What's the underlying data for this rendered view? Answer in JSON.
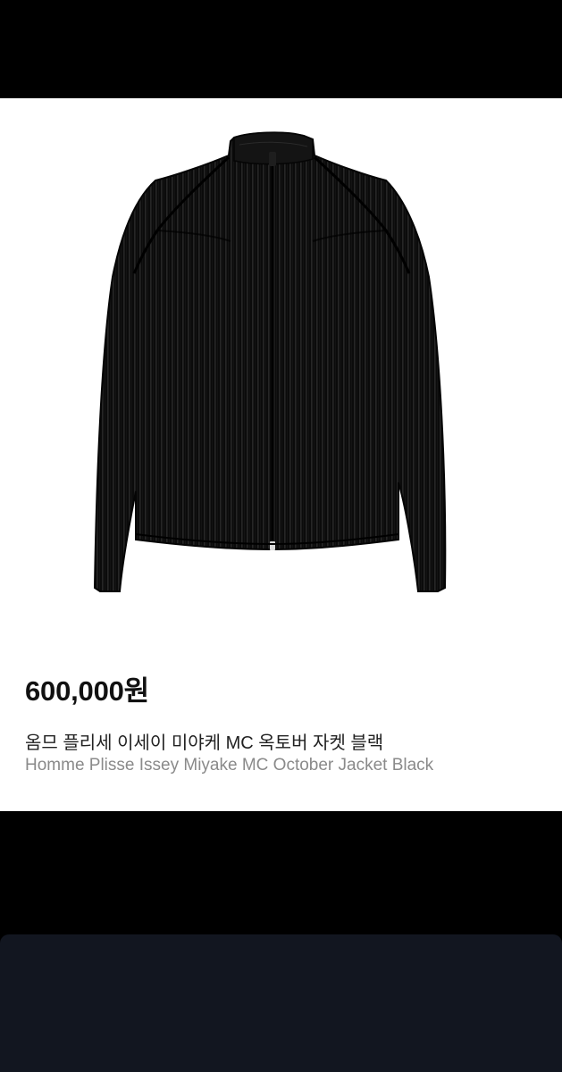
{
  "product": {
    "price": "600,000원",
    "title_ko": "옴므 플리세 이세이 미야케 MC 옥토버 자켓 블랙",
    "title_en": "Homme Plisse Issey Miyake MC October Jacket Black",
    "image_subject": "black pleated zip-up jacket"
  },
  "colors": {
    "top_band": "#000000",
    "card_background": "#ffffff",
    "price_text": "#111111",
    "title_ko_text": "#222222",
    "title_en_text": "#8a8a8a",
    "bottom_panel": "#121620"
  }
}
